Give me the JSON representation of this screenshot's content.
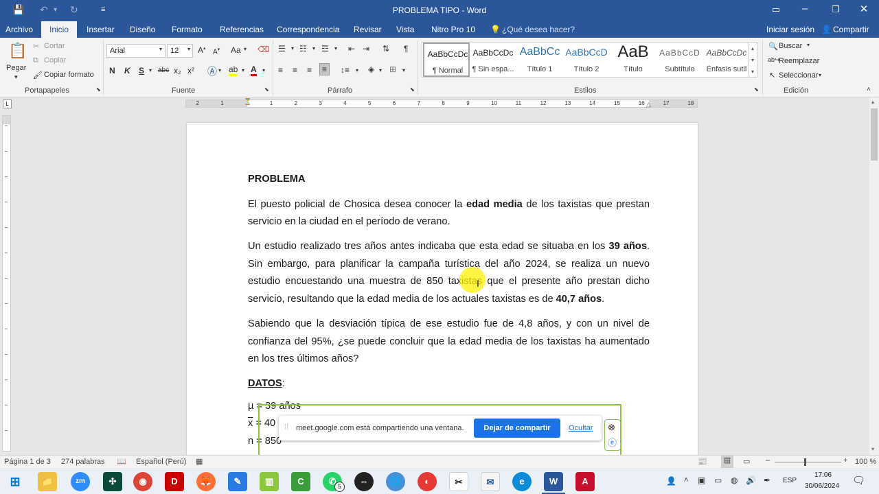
{
  "window": {
    "title": "PROBLEMA TIPO - Word"
  },
  "tabs": [
    "Archivo",
    "Inicio",
    "Insertar",
    "Diseño",
    "Formato",
    "Referencias",
    "Correspondencia",
    "Revisar",
    "Vista",
    "Nitro Pro 10"
  ],
  "tell_me": "¿Qué desea hacer?",
  "account": {
    "signin": "Iniciar sesión",
    "share": "Compartir"
  },
  "clipboard": {
    "paste": "Pegar",
    "cut": "Cortar",
    "copy": "Copiar",
    "format_painter": "Copiar formato",
    "label": "Portapapeles"
  },
  "font": {
    "name": "Arial",
    "size": "12",
    "label": "Fuente",
    "bold": "N",
    "italic": "K",
    "underline": "S",
    "strike": "abc",
    "sub": "x₂",
    "sup": "x²",
    "case": "Aa"
  },
  "paragraph": {
    "label": "Párrafo"
  },
  "styles": {
    "label": "Estilos",
    "items": [
      {
        "preview": "AaBbCcDc",
        "name": "¶ Normal"
      },
      {
        "preview": "AaBbCcDc",
        "name": "¶ Sin espa..."
      },
      {
        "preview": "AaBbCc",
        "name": "Título 1"
      },
      {
        "preview": "AaBbCcD",
        "name": "Título 2"
      },
      {
        "preview": "AaB",
        "name": "Título"
      },
      {
        "preview": "AaBbCcD",
        "name": "Subtítulo"
      },
      {
        "preview": "AaBbCcDc",
        "name": "Énfasis sutil"
      }
    ]
  },
  "editing": {
    "label": "Edición",
    "find": "Buscar",
    "replace": "Reemplazar",
    "select": "Seleccionar"
  },
  "ruler": {
    "numbers": [
      "2",
      "1",
      "1",
      "2",
      "3",
      "4",
      "5",
      "6",
      "7",
      "8",
      "9",
      "10",
      "11",
      "12",
      "13",
      "14",
      "15",
      "16",
      "17",
      "18"
    ]
  },
  "document": {
    "heading": "PROBLEMA",
    "p1": {
      "a": "El puesto policial de Chosica desea conocer la ",
      "b": "edad media",
      "c": " de los taxistas que prestan servicio en la ciudad en el período de verano."
    },
    "p2": {
      "a": "Un estudio realizado tres años antes indicaba que esta edad se situaba en los ",
      "b": "39 años",
      "c": ". Sin embargo, para planificar la campaña turística del año 2024, se realiza un nuevo estudio encuestando una muestra de 850 taxistas que el presente año prestan dicho servicio, resultando que la edad media de los actuales taxistas es de ",
      "d": "40,7 años",
      "e": "."
    },
    "p3": "Sabiendo que la desviación típica de ese estudio fue de 4,8 años, y con un nivel de confianza del 95%, ¿se puede concluir que la edad media de los taxistas ha aumentado en los tres últimos años?",
    "datos": "DATOS",
    "colon": ":",
    "mu": "µ = 39 años",
    "xbar_sym": "x",
    "xbar_val": " = 40",
    "n": "n = 850"
  },
  "share_bar": {
    "text": "meet.google.com está compartiendo una ventana.",
    "stop": "Dejar de compartir",
    "hide": "Ocultar"
  },
  "status": {
    "page": "Página 1 de 3",
    "words": "274 palabras",
    "lang": "Español (Perú)",
    "zoom": "100 %"
  },
  "taskbar": {
    "time": "17:06",
    "date": "30/06/2024",
    "lang": "ESP",
    "badge": "5"
  }
}
